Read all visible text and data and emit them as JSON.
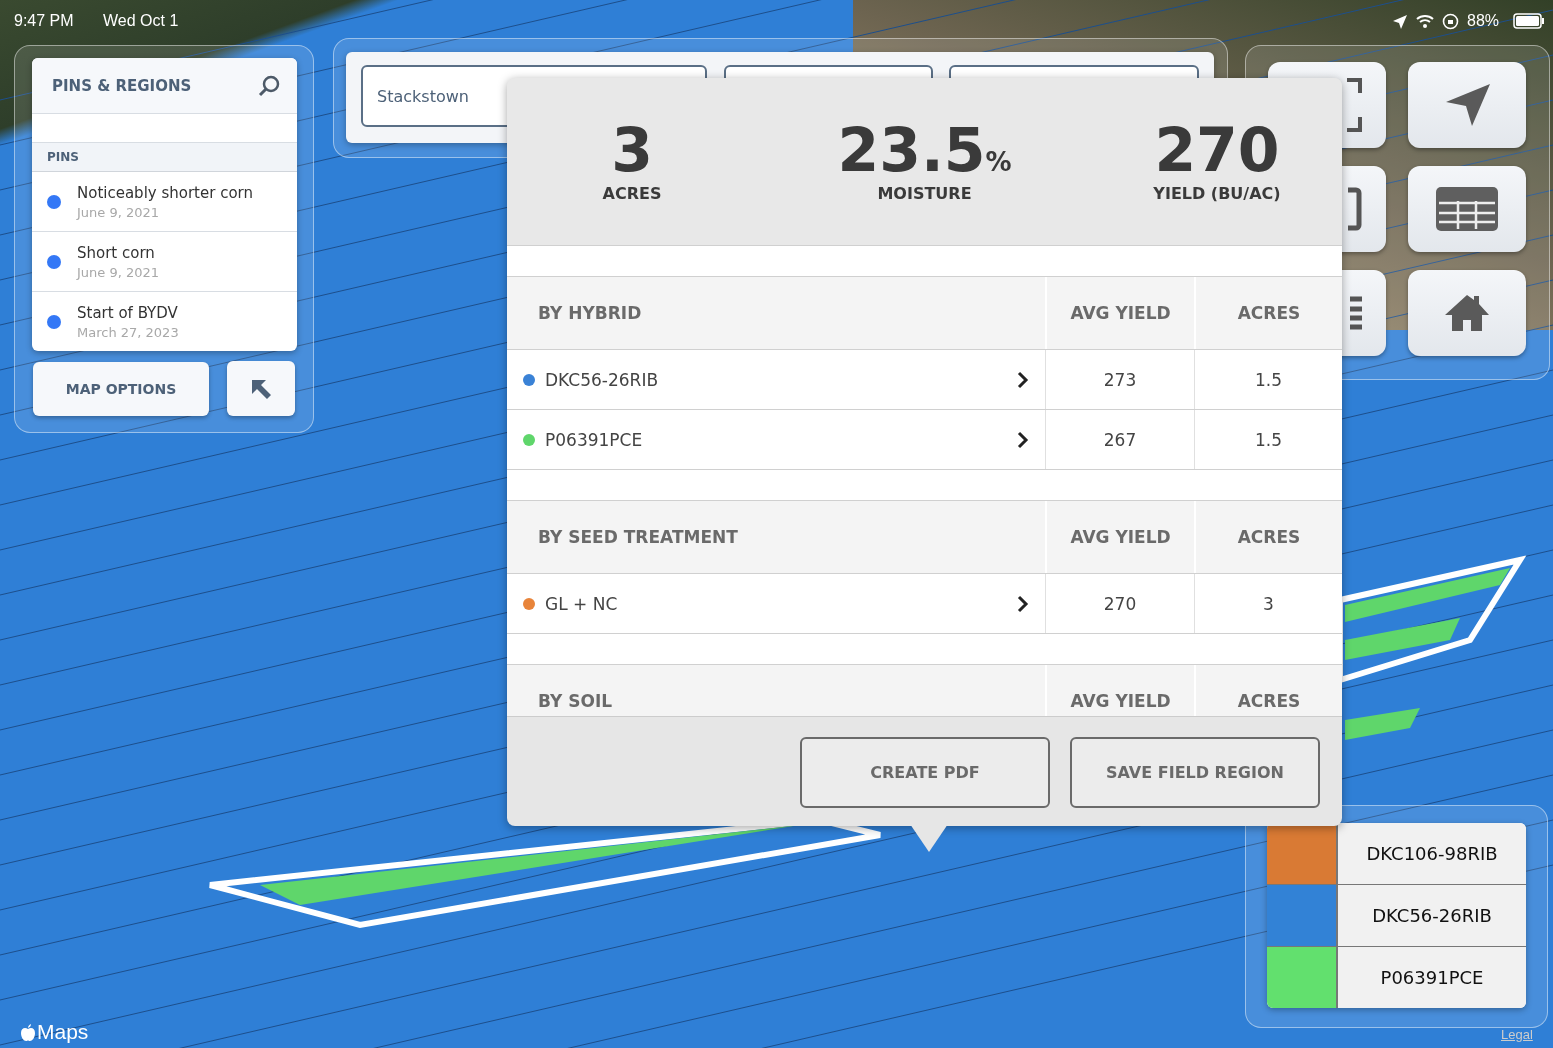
{
  "status_bar": {
    "time": "9:47 PM",
    "date": "Wed Oct 1",
    "battery": "88%"
  },
  "pins_panel": {
    "title": "PINS & REGIONS",
    "section": "PINS",
    "pins": [
      {
        "title": "Noticeably shorter corn",
        "date": "June 9, 2021",
        "color": "#3478f6"
      },
      {
        "title": "Short corn",
        "date": "June 9, 2021",
        "color": "#3478f6"
      },
      {
        "title": "Start of BYDV",
        "date": "March 27, 2023",
        "color": "#3478f6"
      }
    ],
    "map_options": "MAP OPTIONS"
  },
  "field_tabs": [
    {
      "label": "Stackstown"
    }
  ],
  "summary": {
    "stats": [
      {
        "value": "3",
        "label": "ACRES"
      },
      {
        "value": "23.5",
        "unit": "%",
        "label": "MOISTURE"
      },
      {
        "value": "270",
        "label": "YIELD (BU/AC)"
      }
    ],
    "sections": [
      {
        "title": "BY HYBRID",
        "columns": [
          "AVG YIELD",
          "ACRES"
        ],
        "rows": [
          {
            "name": "DKC56-26RIB",
            "color": "#3a82d6",
            "avg_yield": "273",
            "acres": "1.5"
          },
          {
            "name": "P06391PCE",
            "color": "#5fd66b",
            "avg_yield": "267",
            "acres": "1.5"
          }
        ]
      },
      {
        "title": "BY SEED TREATMENT",
        "columns": [
          "AVG YIELD",
          "ACRES"
        ],
        "rows": [
          {
            "name": "GL + NC",
            "color": "#e8843a",
            "avg_yield": "270",
            "acres": "3"
          }
        ]
      },
      {
        "title": "BY SOIL",
        "columns": [
          "AVG YIELD",
          "ACRES"
        ]
      }
    ],
    "buttons": [
      "CREATE PDF",
      "SAVE FIELD REGION"
    ]
  },
  "legend": [
    {
      "label": "DKC106-98RIB",
      "color": "#d97a34"
    },
    {
      "label": "DKC56-26RIB",
      "color": "#3282d6"
    },
    {
      "label": "P06391PCE",
      "color": "#62e06e"
    }
  ],
  "attribution": "Maps",
  "legal": "Legal"
}
